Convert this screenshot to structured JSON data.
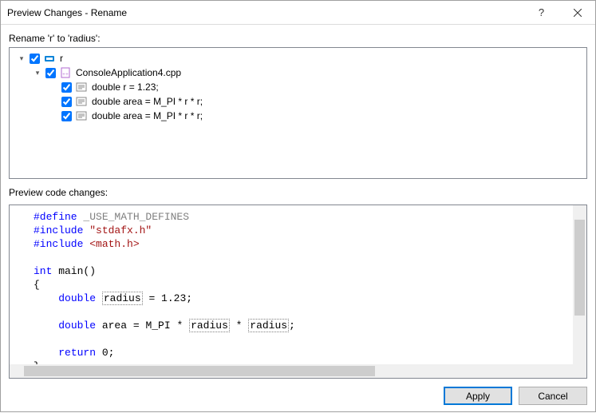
{
  "window": {
    "title": "Preview Changes - Rename"
  },
  "labels": {
    "rename_heading": "Rename 'r' to 'radius':",
    "preview_heading": "Preview code changes:"
  },
  "tree": {
    "root": {
      "label": "r",
      "checked": true
    },
    "file": {
      "label": "ConsoleApplication4.cpp",
      "checked": true
    },
    "items": [
      {
        "label": "double r = 1.23;",
        "checked": true
      },
      {
        "label": "double area = M_PI * r * r;",
        "checked": true
      },
      {
        "label": "double area = M_PI * r * r;",
        "checked": true
      }
    ]
  },
  "code": {
    "l1_kw": "#define",
    "l1_rest": " _USE_MATH_DEFINES",
    "l2_kw": "#include",
    "l2_str": " \"stdafx.h\"",
    "l3_kw": "#include",
    "l3_a": " <math.h>",
    "l5_t": "int",
    "l5_n": " main()",
    "l6": "{",
    "l7_pad": "    ",
    "l7_t": "double",
    "l7_sp": " ",
    "l7_r": "radius",
    "l7_rest": " = 1.23;",
    "l9_pad": "    ",
    "l9_t": "double",
    "l9_a": " area = M_PI * ",
    "l9_r1": "radius",
    "l9_m": " * ",
    "l9_r2": "radius",
    "l9_end": ";",
    "l11_pad": "    ",
    "l11_kw": "return",
    "l11_rest": " 0;",
    "l12": "}"
  },
  "buttons": {
    "apply": "Apply",
    "cancel": "Cancel"
  }
}
